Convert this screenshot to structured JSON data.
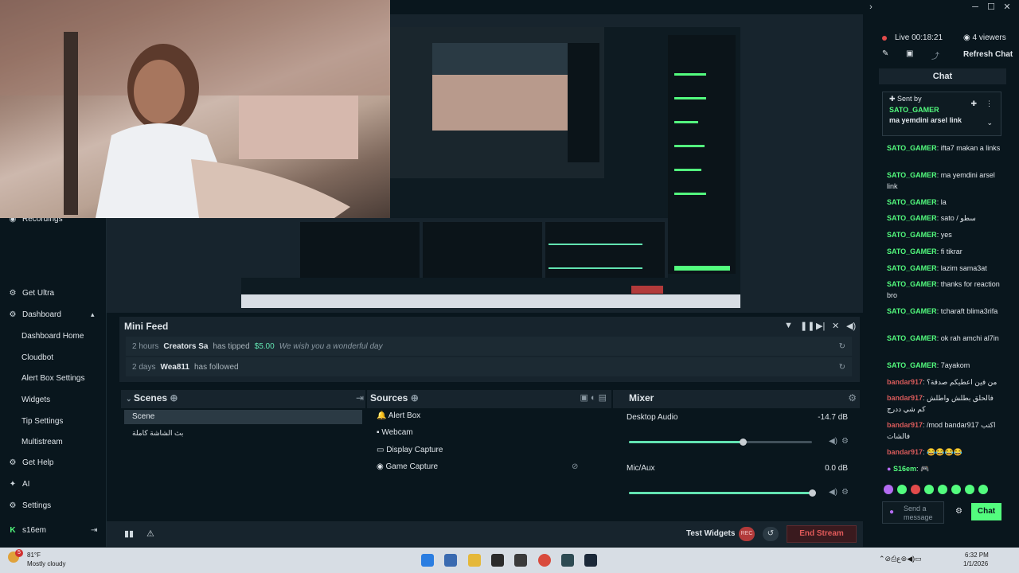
{
  "window": {
    "min": "─",
    "max": "☐",
    "close": "✕"
  },
  "sidebar": {
    "recordings": "Recordings",
    "get_ultra": "Get Ultra",
    "dashboard": "Dashboard",
    "items": [
      "Dashboard Home",
      "Cloudbot",
      "Alert Box Settings",
      "Widgets",
      "Tip Settings",
      "Multistream"
    ],
    "get_help": "Get Help",
    "ai": "AI",
    "settings": "Settings",
    "user": "s16em"
  },
  "mini_feed": {
    "title": "Mini Feed",
    "rows": [
      {
        "time": "2 hours",
        "name": "Creators Sa",
        "action": "has tipped",
        "amount": "$5.00",
        "message": "We wish you a wonderful day"
      },
      {
        "time": "2 days",
        "name": "Wea811",
        "action": "has followed",
        "amount": "",
        "message": ""
      }
    ]
  },
  "scenes": {
    "title": "Scenes",
    "items": [
      "Scene",
      "بث الشاشة كاملة"
    ]
  },
  "sources": {
    "title": "Sources",
    "items": [
      "Alert Box",
      "Webcam",
      "Display Capture",
      "Game Capture"
    ]
  },
  "mixer": {
    "title": "Mixer",
    "channels": [
      {
        "name": "Desktop Audio",
        "level": "-14.7 dB",
        "fader": 0.6
      },
      {
        "name": "Mic/Aux",
        "level": "0.0 dB",
        "fader": 1.0
      }
    ]
  },
  "bottom": {
    "test_widgets": "Test Widgets",
    "rec": "REC",
    "end_stream": "End Stream"
  },
  "chat": {
    "live": "Live 00:18:21",
    "viewers": "4 viewers",
    "refresh": "Refresh Chat",
    "title": "Chat",
    "pinned_label": "Sent by",
    "pinned_user": "SATO_GAMER",
    "pinned_text": "ma yemdini arsel link",
    "messages": [
      {
        "user": "SATO_GAMER",
        "text": "ifta7 makan a links",
        "color": "green"
      },
      {
        "user": "SATO_GAMER",
        "text": "ma yemdini arsel link",
        "color": "green"
      },
      {
        "user": "SATO_GAMER",
        "text": "la",
        "color": "green"
      },
      {
        "user": "SATO_GAMER",
        "text": "sato / سطو",
        "color": "green"
      },
      {
        "user": "SATO_GAMER",
        "text": "yes",
        "color": "green"
      },
      {
        "user": "SATO_GAMER",
        "text": "fi tikrar",
        "color": "green"
      },
      {
        "user": "SATO_GAMER",
        "text": "lazim sama3at",
        "color": "green"
      },
      {
        "user": "SATO_GAMER",
        "text": "thanks for reaction bro",
        "color": "green"
      },
      {
        "user": "SATO_GAMER",
        "text": "tcharaft blima3rifa",
        "color": "green"
      },
      {
        "user": "SATO_GAMER",
        "text": "ok rah amchi al7in",
        "color": "green"
      },
      {
        "user": "SATO_GAMER",
        "text": "7ayakom",
        "color": "green"
      },
      {
        "user": "bandar917",
        "text": "من فين اعطيكم صدقة؟",
        "color": "red"
      },
      {
        "user": "bandar917",
        "text": "فالحلق بطلش واطلش كم شي ددرج",
        "color": "red"
      },
      {
        "user": "bandar917",
        "text": "/mod bandar917 اكتب فالشات",
        "color": "red"
      },
      {
        "user": "bandar917",
        "text": "😂😂😂😂",
        "color": "red"
      },
      {
        "user": "S16em",
        "text": "🎮",
        "color": "green"
      }
    ],
    "send_placeholder": "Send a message",
    "chat_button": "Chat"
  },
  "taskbar": {
    "weather_temp": "81°F",
    "weather_desc": "Mostly cloudy",
    "badge": "5",
    "time": "6:32 PM",
    "date": "1/1/2026"
  }
}
